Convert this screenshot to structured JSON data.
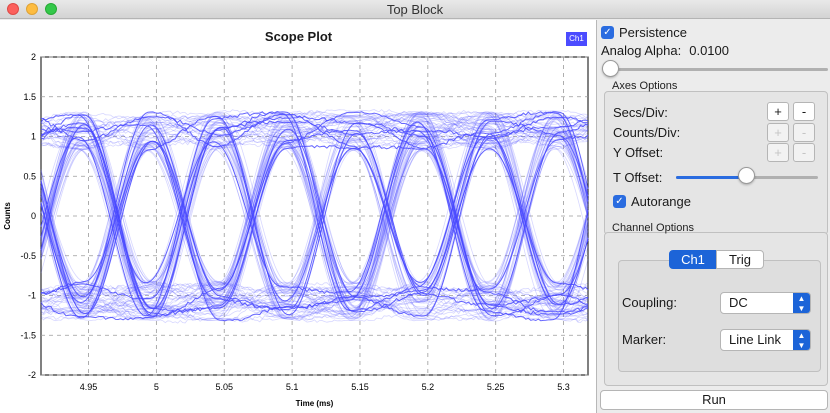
{
  "window": {
    "title": "Top Block"
  },
  "plot": {
    "title": "Scope Plot",
    "legend": "Ch1",
    "trace_color": "#4b4bff"
  },
  "chart_data": {
    "type": "line",
    "title": "Scope Plot",
    "xlabel": "Time (ms)",
    "ylabel": "Counts",
    "xlim": [
      4.915,
      5.318
    ],
    "ylim": [
      -2,
      2
    ],
    "x_ticks": [
      "4.95",
      "5",
      "5.05",
      "5.1",
      "5.15",
      "5.2",
      "5.25",
      "5.3"
    ],
    "y_ticks": [
      "2",
      "1.5",
      "1",
      "0.5",
      "0",
      "-0.5",
      "-1",
      "-1.5",
      "-2"
    ],
    "grid": true,
    "legend": "top-right",
    "series": [
      {
        "name": "Ch1",
        "description_levels": [
          -1,
          1
        ],
        "symbol_period_ms": 0.05,
        "symbol_centers_ms": [
          4.945,
          4.995,
          5.045,
          5.095,
          5.145,
          5.195,
          5.245,
          5.295
        ]
      }
    ]
  },
  "controls": {
    "persistence_label": "Persistence",
    "persistence_checked": true,
    "analog_alpha_label": "Analog Alpha:",
    "analog_alpha_value": "0.0100",
    "axes_group": "Axes Options",
    "secs_div": "Secs/Div:",
    "counts_div": "Counts/Div:",
    "y_offset": "Y Offset:",
    "t_offset": "T Offset:",
    "t_offset_level": 0.52,
    "analog_alpha_level": 0.0,
    "plus": "+",
    "minus": "-",
    "autorange_label": "Autorange",
    "autorange_checked": true,
    "channel_group": "Channel Options",
    "tab_ch1": "Ch1",
    "tab_trig": "Trig",
    "coupling_label": "Coupling:",
    "coupling_value": "DC",
    "marker_label": "Marker:",
    "marker_value": "Line Link",
    "run_label": "Run"
  }
}
